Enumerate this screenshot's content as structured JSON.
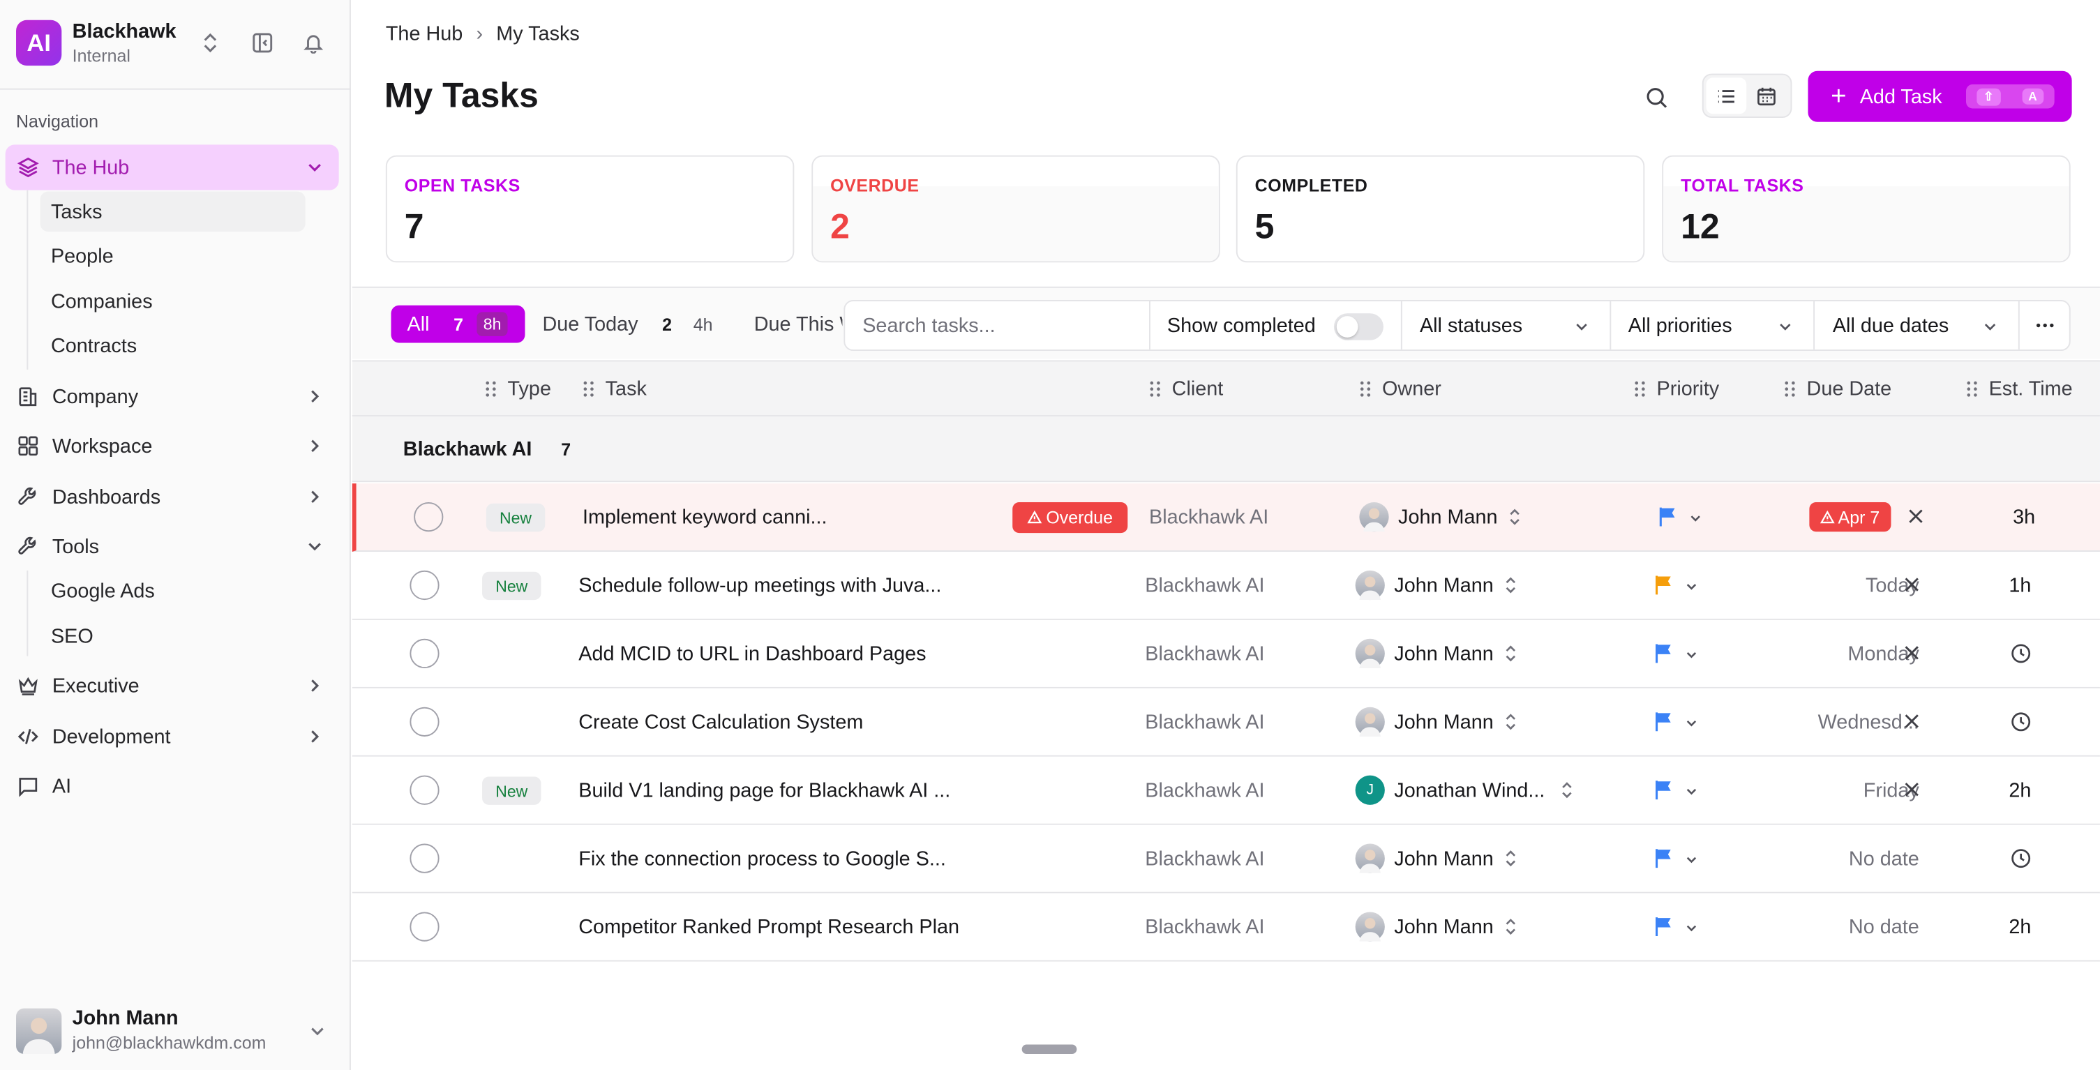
{
  "workspace": {
    "logo": "AI",
    "name": "Blackhawk",
    "subtitle": "Internal"
  },
  "nav": {
    "heading": "Navigation",
    "hub": {
      "label": "The Hub",
      "children": [
        "Tasks",
        "People",
        "Companies",
        "Contracts"
      ]
    },
    "items": [
      "Company",
      "Workspace",
      "Dashboards"
    ],
    "tools": {
      "label": "Tools",
      "children": [
        "Google Ads",
        "SEO"
      ]
    },
    "items2": [
      "Executive",
      "Development",
      "AI"
    ]
  },
  "user": {
    "name": "John Mann",
    "email": "john@blackhawkdm.com"
  },
  "breadcrumb": {
    "root": "The Hub",
    "sep": "›",
    "current": "My Tasks"
  },
  "page": {
    "title": "My Tasks"
  },
  "toolbar": {
    "add_label": "Add Task",
    "kbd_shift": "⇧",
    "kbd_key": "A"
  },
  "stats": [
    {
      "label": "OPEN TASKS",
      "value": "7",
      "color": "#c000e8"
    },
    {
      "label": "OVERDUE",
      "value": "2",
      "color": "#ef4444"
    },
    {
      "label": "COMPLETED",
      "value": "5",
      "color": "#18181b"
    },
    {
      "label": "TOTAL TASKS",
      "value": "12",
      "color": "#c000e8"
    }
  ],
  "filters": {
    "all": {
      "label": "All",
      "count": "7",
      "hours": "8h"
    },
    "today": {
      "label": "Due Today",
      "count": "2",
      "hours": "4h"
    },
    "week": {
      "label": "Due This Week"
    },
    "search_placeholder": "Search tasks...",
    "show_completed": "Show completed",
    "status": "All statuses",
    "priority": "All priorities",
    "due": "All due dates"
  },
  "columns": {
    "type": "Type",
    "task": "Task",
    "client": "Client",
    "owner": "Owner",
    "priority": "Priority",
    "due": "Due Date",
    "est": "Est. Time"
  },
  "group": {
    "name": "Blackhawk AI",
    "count": "7"
  },
  "colors": {
    "accent": "#c000e8",
    "danger": "#ef4444",
    "flag_blue": "#3b82f6",
    "flag_amber": "#f59e0b"
  },
  "rows": [
    {
      "new": "New",
      "task": "Implement keyword canni...",
      "status_badge": "Overdue",
      "client": "Blackhawk AI",
      "owner": "John Mann",
      "flag": "blue",
      "due": "Apr 7",
      "est": "3h"
    },
    {
      "new": "New",
      "task": "Schedule follow-up meetings with Juva...",
      "client": "Blackhawk AI",
      "owner": "John Mann",
      "flag": "amber",
      "due": "Today",
      "est": "1h"
    },
    {
      "new": "",
      "task": "Add MCID to URL in Dashboard Pages",
      "client": "Blackhawk AI",
      "owner": "John Mann",
      "flag": "blue",
      "due": "Monday",
      "est": ""
    },
    {
      "new": "",
      "task": "Create Cost Calculation System",
      "client": "Blackhawk AI",
      "owner": "John Mann",
      "flag": "blue",
      "due": "Wednesd...",
      "est": ""
    },
    {
      "new": "New",
      "task": "Build V1 landing page for Blackhawk AI ...",
      "client": "Blackhawk AI",
      "owner": "Jonathan Wind...",
      "owner_initial": "J",
      "flag": "blue",
      "due": "Friday",
      "est": "2h"
    },
    {
      "new": "",
      "task": "Fix the connection process to Google S...",
      "client": "Blackhawk AI",
      "owner": "John Mann",
      "flag": "blue",
      "due": "No date",
      "est": ""
    },
    {
      "new": "",
      "task": "Competitor Ranked Prompt Research Plan",
      "client": "Blackhawk AI",
      "owner": "John Mann",
      "flag": "blue",
      "due": "No date",
      "est": "2h"
    }
  ]
}
